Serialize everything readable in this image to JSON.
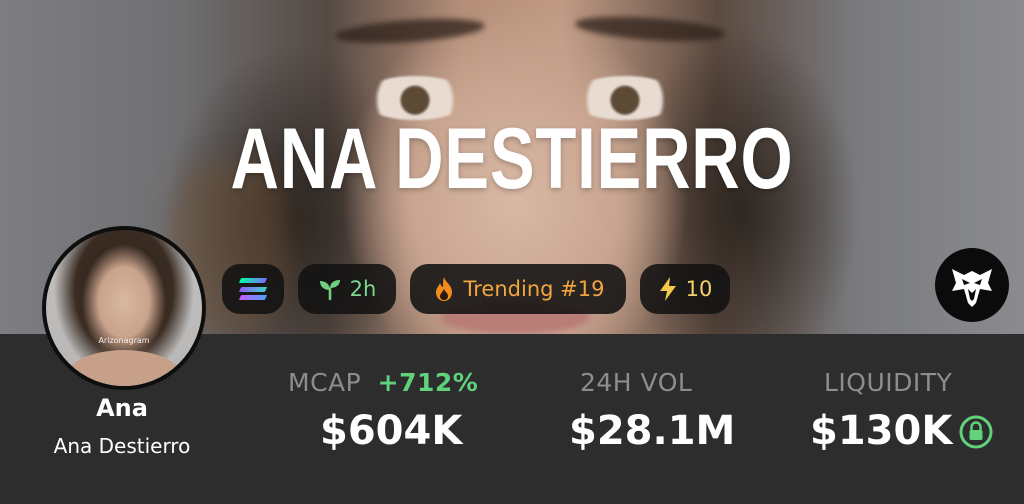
{
  "banner": {
    "title": "ANA DESTIERRO"
  },
  "token": {
    "symbol_name": "Ana",
    "full_name": "Ana Destierro",
    "avatar_watermark": "Arizonagram"
  },
  "badges": {
    "chain_icon": "solana-icon",
    "age_icon": "sprout-icon",
    "age": "2h",
    "trending_icon": "fire-icon",
    "trending": "Trending #19",
    "boost_icon": "lightning-icon",
    "boosts": "10"
  },
  "logo_icon": "eagle-icon",
  "stats": {
    "mcap_label": "MCAP",
    "mcap_change": "+712%",
    "mcap_value": "$604K",
    "vol_label": "24H VOL",
    "vol_value": "$28.1M",
    "liquidity_label": "LIQUIDITY",
    "liquidity_value": "$130K",
    "liquidity_icon": "lock-icon"
  },
  "colors": {
    "panel_bg": "#2d2d2d",
    "positive": "#5fd27b",
    "label_gray": "#8d8d8d",
    "trending_orange": "#f3a53d",
    "boost_yellow": "#f4d36a",
    "age_green": "#7bd88f"
  }
}
